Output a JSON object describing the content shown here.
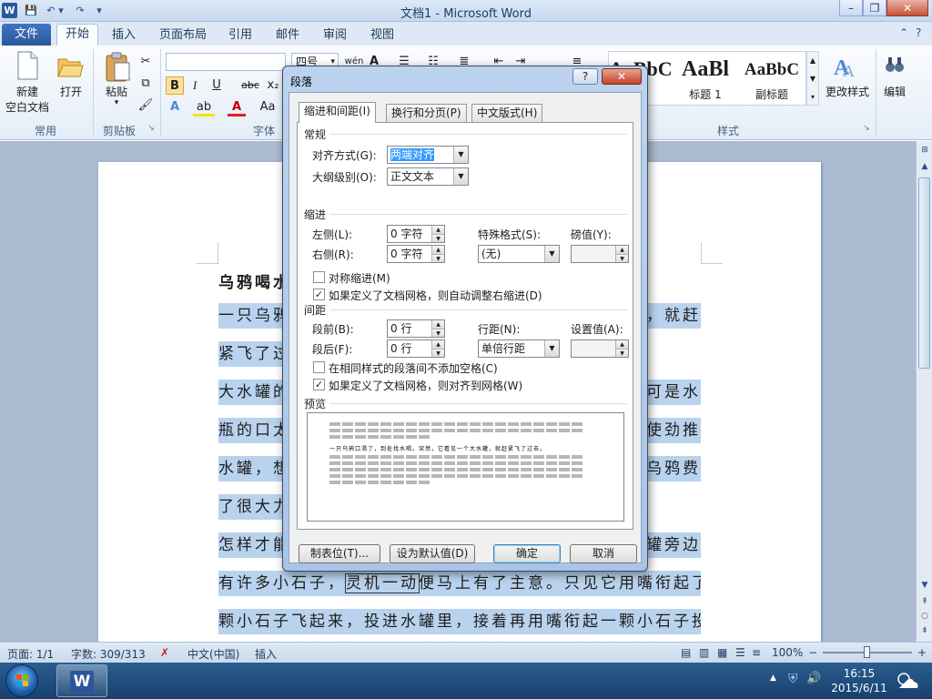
{
  "window": {
    "title": "文档1 - Microsoft Word",
    "app_icon_letter": "W",
    "controls": {
      "minimize": "–",
      "restore": "❐",
      "close": "✕"
    }
  },
  "quick_access": {
    "save": "💾",
    "undo": "↶",
    "undo_drop": "▾",
    "redo": "↷",
    "customize": "▾"
  },
  "ribbon_tabs": {
    "file": "文件",
    "tabs": [
      "开始",
      "插入",
      "页面布局",
      "引用",
      "邮件",
      "审阅",
      "视图"
    ],
    "active_index": 0,
    "help_icons": [
      "⌃",
      "?"
    ]
  },
  "ribbon": {
    "common": {
      "new_label": "新建\n空白文档",
      "new_line1": "新建",
      "new_line2": "空白文档",
      "open_label": "打开",
      "group": "常用"
    },
    "clipboard": {
      "paste_label": "粘贴",
      "paste_drop": "▾",
      "group": "剪贴板",
      "launcher": "↘"
    },
    "font": {
      "size_value": "四号",
      "size_drop": "▾",
      "grow": "wén",
      "bold": "B",
      "italic": "I",
      "underline": "U",
      "strike": "abc",
      "subscript": "x₂",
      "font_color": "A",
      "highlight": "ab",
      "case": "Aa",
      "group": "字体"
    },
    "styles": {
      "items": [
        {
          "sample": "AaBbC",
          "name": ""
        },
        {
          "sample": "AaBl",
          "name": "标题 1"
        },
        {
          "sample": "AaBbC",
          "name": "副标题"
        }
      ],
      "change_styles": "更改样式",
      "group": "样式",
      "launcher": "↘"
    },
    "editing": {
      "label": "编辑"
    }
  },
  "document": {
    "title_line": "乌鸦喝水",
    "lines": [
      {
        "left": "一只乌鸦",
        "right": "，就赶"
      },
      {
        "left": "紧飞了过",
        "right": ""
      },
      {
        "left": "大水罐的",
        "right": "可是水"
      },
      {
        "left": "瓶的口太",
        "right": "使劲推"
      },
      {
        "left": "水罐，想",
        "right": "乌鸦费"
      },
      {
        "left": "了很大力",
        "right": ""
      },
      {
        "left": "怎样才能",
        "right": "罐旁边"
      }
    ],
    "line_full_1_pre": "有许多小石子，",
    "line_full_1_boxed": "灵机一动",
    "line_full_1_post": "便马上有了主意。只见它用嘴衔起了一",
    "line_full_2": "颗小石子飞起来，投进水罐里，接着再用嘴衔起一颗小石子投进"
  },
  "statusbar": {
    "page": "页面: 1/1",
    "words": "字数: 309/313",
    "proof_icon": "✗",
    "language": "中文(中国)",
    "mode": "插入",
    "zoom": "100%",
    "zoom_minus": "−",
    "zoom_plus": "+",
    "zoom_level": 0.5
  },
  "taskbar": {
    "time": "16:15",
    "date": "2015/6/11",
    "tray": [
      "▲",
      "⛨",
      "🔊"
    ]
  },
  "dialog": {
    "title": "段落",
    "help": "?",
    "close": "✕",
    "tabs": [
      "缩进和间距(I)",
      "换行和分页(P)",
      "中文版式(H)"
    ],
    "active_tab": 0,
    "general": {
      "heading": "常规",
      "align_label": "对齐方式(G):",
      "align_value": "两端对齐",
      "outline_label": "大纲级别(O):",
      "outline_value": "正文文本"
    },
    "indent": {
      "heading": "缩进",
      "left_label": "左侧(L):",
      "left_value": "0 字符",
      "right_label": "右侧(R):",
      "right_value": "0 字符",
      "special_label": "特殊格式(S):",
      "special_value": "(无)",
      "by_label": "磅值(Y):",
      "by_value": "",
      "mirror_label": "对称缩进(M)",
      "mirror_checked": false,
      "auto_adjust_label": "如果定义了文档网格，则自动调整右缩进(D)",
      "auto_adjust_checked": true
    },
    "spacing": {
      "heading": "间距",
      "before_label": "段前(B):",
      "before_value": "0 行",
      "after_label": "段后(F):",
      "after_value": "0 行",
      "line_label": "行距(N):",
      "line_value": "单倍行距",
      "at_label": "设置值(A):",
      "at_value": "",
      "no_space_label": "在相同样式的段落间不添加空格(C)",
      "no_space_checked": false,
      "snap_grid_label": "如果定义了文档网格，则对齐到网格(W)",
      "snap_grid_checked": true
    },
    "preview": {
      "heading": "预览",
      "sample_text": "一只乌鸦口渴了，到处找水喝。突然，它看见一个大水罐，就赶紧飞了过去。"
    },
    "buttons": {
      "tabs": "制表位(T)...",
      "default": "设为默认值(D)",
      "ok": "确定",
      "cancel": "取消"
    }
  }
}
